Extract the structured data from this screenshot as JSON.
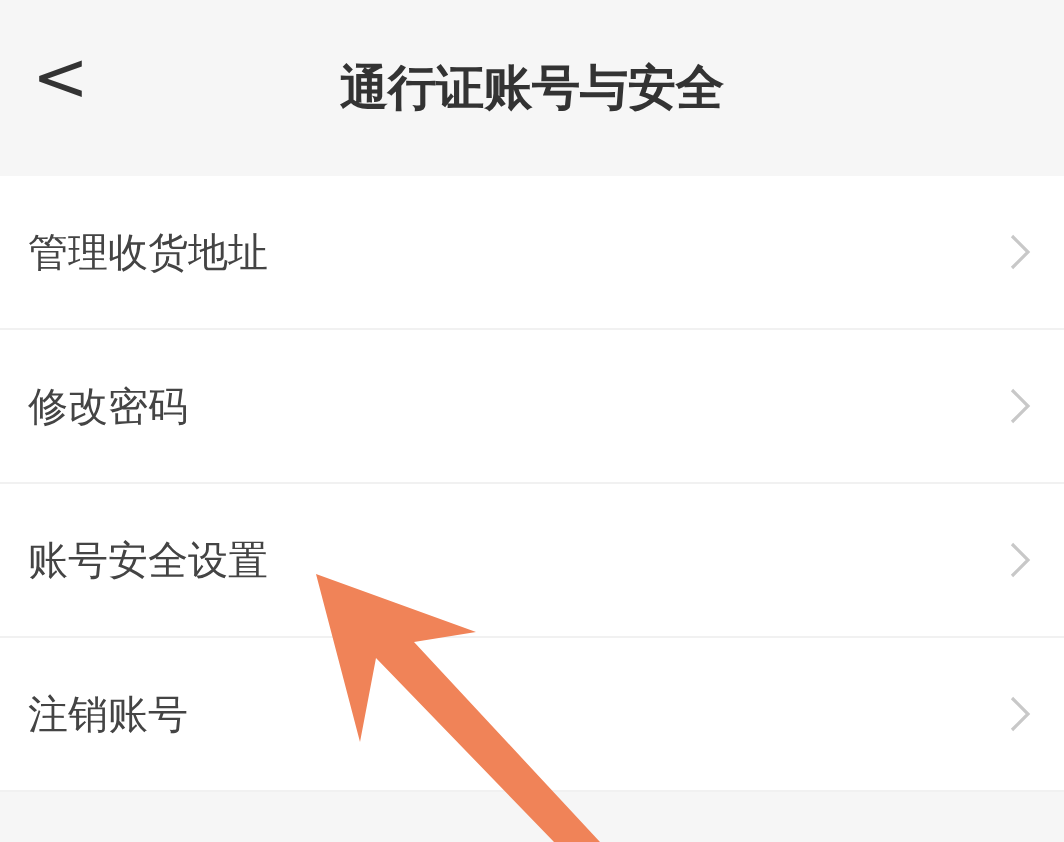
{
  "header": {
    "back": "<",
    "title": "通行证账号与安全"
  },
  "items": [
    {
      "label": "管理收货地址"
    },
    {
      "label": "修改密码"
    },
    {
      "label": "账号安全设置"
    },
    {
      "label": "注销账号"
    }
  ],
  "annotation": {
    "kind": "arrow"
  }
}
